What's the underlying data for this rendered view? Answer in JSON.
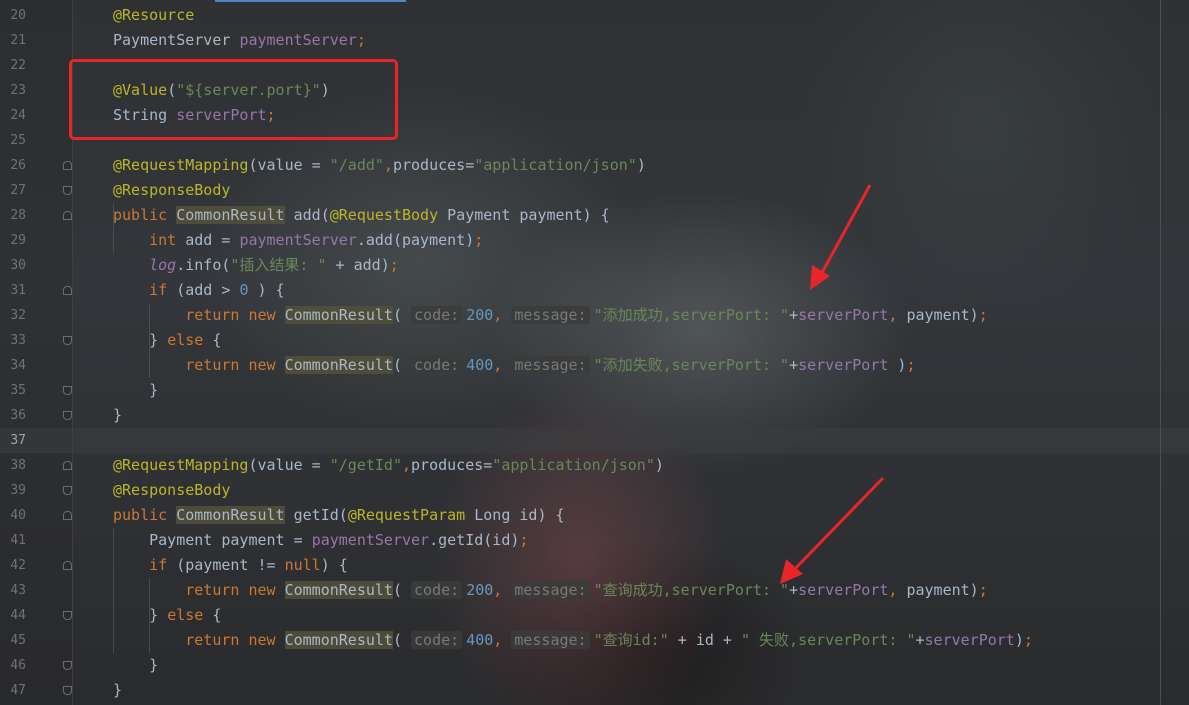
{
  "editor": {
    "lines": [
      {
        "n": "20",
        "tokens": [
          [
            "ann",
            "@Resource"
          ]
        ]
      },
      {
        "n": "21",
        "tokens": [
          [
            "",
            "PaymentServer "
          ],
          [
            "fld",
            "paymentServer"
          ],
          [
            "kw",
            ";"
          ]
        ]
      },
      {
        "n": "22",
        "tokens": []
      },
      {
        "n": "23",
        "tokens": [
          [
            "ann",
            "@Value"
          ],
          [
            "",
            "("
          ],
          [
            "str",
            "\"${server.port}\""
          ],
          [
            "",
            ")"
          ]
        ]
      },
      {
        "n": "24",
        "tokens": [
          [
            "",
            "String "
          ],
          [
            "fld",
            "serverPort"
          ],
          [
            "kw",
            ";"
          ]
        ]
      },
      {
        "n": "25",
        "tokens": []
      },
      {
        "n": "26",
        "tokens": [
          [
            "ann",
            "@RequestMapping"
          ],
          [
            "",
            "(value = "
          ],
          [
            "str",
            "\"/add\""
          ],
          [
            "kw",
            ","
          ],
          [
            "",
            "produces="
          ],
          [
            "str",
            "\"application/json\""
          ],
          [
            "",
            ")"
          ]
        ]
      },
      {
        "n": "27",
        "tokens": [
          [
            "ann",
            "@ResponseBody"
          ]
        ]
      },
      {
        "n": "28",
        "tokens": [
          [
            "kw",
            "public "
          ],
          [
            "hl",
            "CommonResult"
          ],
          [
            "",
            " add("
          ],
          [
            "ann",
            "@RequestBody"
          ],
          [
            "",
            " Payment payment) {"
          ]
        ]
      },
      {
        "n": "29",
        "tokens": [
          [
            "",
            "    "
          ],
          [
            "kw",
            "int "
          ],
          [
            "",
            "add = "
          ],
          [
            "fld",
            "paymentServer"
          ],
          [
            "",
            ".add(payment)"
          ],
          [
            "kw",
            ";"
          ]
        ]
      },
      {
        "n": "30",
        "tokens": [
          [
            "",
            "    "
          ],
          [
            "fld italic",
            "log"
          ],
          [
            "",
            ".info("
          ],
          [
            "str",
            "\"插入结果: \""
          ],
          [
            "",
            " + add)"
          ],
          [
            "kw",
            ";"
          ]
        ]
      },
      {
        "n": "31",
        "tokens": [
          [
            "",
            "    "
          ],
          [
            "kw",
            "if "
          ],
          [
            "",
            "(add > "
          ],
          [
            "num",
            "0"
          ],
          [
            "",
            " ) {"
          ]
        ]
      },
      {
        "n": "32",
        "tokens": [
          [
            "",
            "        "
          ],
          [
            "kw",
            "return new "
          ],
          [
            "hl",
            "CommonResult"
          ],
          [
            "",
            "( "
          ],
          [
            "hint",
            "code:"
          ],
          [
            "num",
            "200"
          ],
          [
            "kw",
            ", "
          ],
          [
            "hint",
            "message:"
          ],
          [
            "str",
            "\"添加成功,serverPort: \""
          ],
          [
            "",
            "+"
          ],
          [
            "fld",
            "serverPort"
          ],
          [
            "kw",
            ", "
          ],
          [
            "",
            "payment)"
          ],
          [
            "kw",
            ";"
          ]
        ]
      },
      {
        "n": "33",
        "tokens": [
          [
            "",
            "    } "
          ],
          [
            "kw",
            "else "
          ],
          [
            "",
            "{"
          ]
        ]
      },
      {
        "n": "34",
        "tokens": [
          [
            "",
            "        "
          ],
          [
            "kw",
            "return new "
          ],
          [
            "hl",
            "CommonResult"
          ],
          [
            "",
            "( "
          ],
          [
            "hint",
            "code:"
          ],
          [
            "num",
            "400"
          ],
          [
            "kw",
            ", "
          ],
          [
            "hint",
            "message:"
          ],
          [
            "str",
            "\"添加失败,serverPort: \""
          ],
          [
            "",
            "+"
          ],
          [
            "fld",
            "serverPort"
          ],
          [
            "",
            " )"
          ],
          [
            "kw",
            ";"
          ]
        ]
      },
      {
        "n": "35",
        "tokens": [
          [
            "",
            "    }"
          ]
        ]
      },
      {
        "n": "36",
        "tokens": [
          [
            "",
            "}"
          ]
        ]
      },
      {
        "n": "37",
        "tokens": []
      },
      {
        "n": "38",
        "tokens": [
          [
            "ann",
            "@RequestMapping"
          ],
          [
            "",
            "(value = "
          ],
          [
            "str",
            "\"/getId\""
          ],
          [
            "kw",
            ","
          ],
          [
            "",
            "produces="
          ],
          [
            "str",
            "\"application/json\""
          ],
          [
            "",
            ")"
          ]
        ]
      },
      {
        "n": "39",
        "tokens": [
          [
            "ann",
            "@ResponseBody"
          ]
        ]
      },
      {
        "n": "40",
        "tokens": [
          [
            "kw",
            "public "
          ],
          [
            "hl",
            "CommonResult"
          ],
          [
            "",
            " getId("
          ],
          [
            "ann",
            "@RequestParam"
          ],
          [
            "",
            " Long id) {"
          ]
        ]
      },
      {
        "n": "41",
        "tokens": [
          [
            "",
            "    Payment payment = "
          ],
          [
            "fld",
            "paymentServer"
          ],
          [
            "",
            ".getId(id)"
          ],
          [
            "kw",
            ";"
          ]
        ]
      },
      {
        "n": "42",
        "tokens": [
          [
            "",
            "    "
          ],
          [
            "kw",
            "if "
          ],
          [
            "",
            "(payment != "
          ],
          [
            "kw",
            "null"
          ],
          [
            "",
            ") {"
          ]
        ]
      },
      {
        "n": "43",
        "tokens": [
          [
            "",
            "        "
          ],
          [
            "kw",
            "return new "
          ],
          [
            "hl",
            "CommonResult"
          ],
          [
            "",
            "( "
          ],
          [
            "hint",
            "code:"
          ],
          [
            "num",
            "200"
          ],
          [
            "kw",
            ", "
          ],
          [
            "hint",
            "message:"
          ],
          [
            "str",
            "\"查询成功,serverPort: \""
          ],
          [
            "",
            "+"
          ],
          [
            "fld",
            "serverPort"
          ],
          [
            "kw",
            ", "
          ],
          [
            "",
            "payment)"
          ],
          [
            "kw",
            ";"
          ]
        ]
      },
      {
        "n": "44",
        "tokens": [
          [
            "",
            "    } "
          ],
          [
            "kw",
            "else "
          ],
          [
            "",
            "{"
          ]
        ]
      },
      {
        "n": "45",
        "tokens": [
          [
            "",
            "        "
          ],
          [
            "kw",
            "return new "
          ],
          [
            "hl",
            "CommonResult"
          ],
          [
            "",
            "( "
          ],
          [
            "hint",
            "code:"
          ],
          [
            "num",
            "400"
          ],
          [
            "kw",
            ", "
          ],
          [
            "hint",
            "message:"
          ],
          [
            "str",
            "\"查询id:\""
          ],
          [
            "",
            " + id + "
          ],
          [
            "str",
            "\" 失败,serverPort: \""
          ],
          [
            "",
            "+"
          ],
          [
            "fld",
            "serverPort"
          ],
          [
            "",
            ")"
          ],
          [
            "kw",
            ";"
          ]
        ]
      },
      {
        "n": "46",
        "tokens": [
          [
            "",
            "    }"
          ]
        ]
      },
      {
        "n": "47",
        "tokens": [
          [
            "",
            "}"
          ]
        ]
      }
    ],
    "current_line": "37",
    "colors": {
      "keyword": "#cc7832",
      "annotation": "#bbb529",
      "string": "#6a8759",
      "number": "#6897bb",
      "field": "#9876aa",
      "text": "#a9b7c6",
      "highlight_box": "#e8262a"
    }
  }
}
